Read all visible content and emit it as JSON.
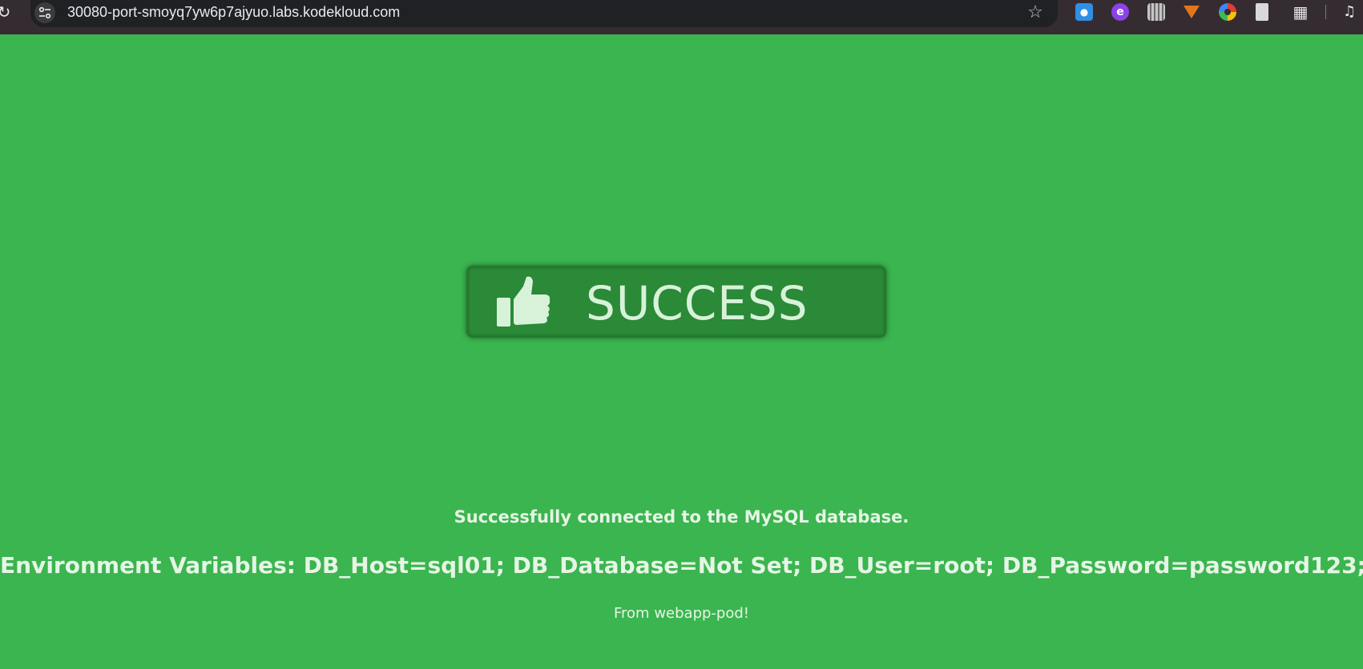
{
  "browser": {
    "url": "30080-port-smoyq7yw6p7ajyuo.labs.kodekloud.com",
    "icons": {
      "reload": "reload-icon",
      "site_info": "tune-icon",
      "bookmark": "star-icon",
      "extensions": [
        "water-drop-extension-icon",
        "e-extension-icon",
        "qr-code-extension-icon",
        "fox-extension-icon",
        "color-picker-extension-icon",
        "document-extension-icon",
        "puzzle-extensions-icon",
        "media-control-icon"
      ]
    }
  },
  "page": {
    "background_color": "#3bb54f",
    "banner": {
      "label": "SUCCESS",
      "icon": "thumbs-up-icon",
      "color": "#2a8a37"
    },
    "status_message": "Successfully connected to the MySQL database.",
    "environment_variables": "Environment Variables: DB_Host=sql01; DB_Database=Not Set; DB_User=root; DB_Password=password123;",
    "source": "From webapp-pod!"
  }
}
